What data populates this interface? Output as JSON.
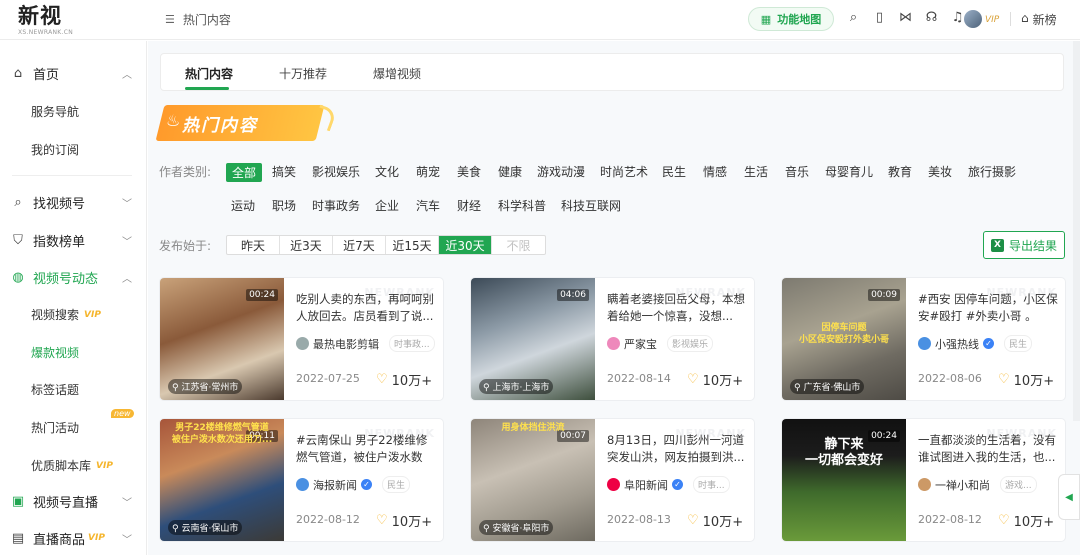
{
  "brand": {
    "title": "新视",
    "subtitle": "XS.NEWRANK.CN"
  },
  "header": {
    "breadcrumb": "热门内容",
    "function_map": "功能地图",
    "new_rank": "新榜",
    "icons": [
      "search-icon",
      "phone-icon",
      "brand-icon",
      "headset-icon",
      "bell-icon"
    ],
    "accent": "#21a651"
  },
  "sidebar": {
    "home": "首页",
    "service_nav": "服务导航",
    "subscriptions": "我的订阅",
    "find_channel": "找视频号",
    "index_rank": "指数榜单",
    "channel_dynamics": "视频号动态",
    "video_search": "视频搜索",
    "viral_videos": "爆款视频",
    "tag_topics": "标签话题",
    "hot_events": "热门活动",
    "quality_scripts": "优质脚本库",
    "live": "视频号直播",
    "live_goods": "直播商品",
    "vip": "VIP",
    "new": "new"
  },
  "tabs": [
    "热门内容",
    "十万推荐",
    "爆增视频"
  ],
  "banner": "热门内容",
  "filters": {
    "author_label": "作者类别:",
    "categories_row1": [
      "全部",
      "搞笑",
      "影视娱乐",
      "文化",
      "萌宠",
      "美食",
      "健康",
      "游戏动漫",
      "时尚艺术",
      "民生",
      "情感",
      "生活",
      "音乐",
      "母婴育儿",
      "教育",
      "美妆",
      "旅行摄影"
    ],
    "categories_row2": [
      "运动",
      "职场",
      "时事政务",
      "企业",
      "汽车",
      "财经",
      "科学科普",
      "科技互联网"
    ],
    "publish_label": "发布始于:",
    "dates": [
      "昨天",
      "近3天",
      "近7天",
      "近15天",
      "近30天",
      "不限"
    ],
    "active_date_index": 4,
    "export": "导出结果"
  },
  "cards": [
    {
      "duration": "00:24",
      "location": "江苏省·常州市",
      "title": "吃别人卖的东西，再呵呵别人放回去。店员看到了说...",
      "author": "最热电影剪辑",
      "category": "时事政...",
      "date": "2022-07-25",
      "likes": "10万+",
      "overlay": "",
      "verified": false
    },
    {
      "duration": "04:06",
      "location": "上海市·上海市",
      "title": "瞒着老婆接回岳父母，本想着给她一个惊喜，没想...",
      "author": "严家宝",
      "category": "影视娱乐",
      "date": "2022-08-14",
      "likes": "10万+",
      "overlay": "",
      "verified": false
    },
    {
      "duration": "00:09",
      "location": "广东省·佛山市",
      "title": "#西安 因停车问题，小区保安#殴打 #外卖小哥 。",
      "author": "小强热线",
      "category": "民生",
      "date": "2022-08-06",
      "likes": "10万+",
      "overlay": "因停车问题\n小区保安殴打外卖小哥",
      "verified": true
    },
    {
      "duration": "00:11",
      "location": "云南省·保山市",
      "title": "#云南保山 男子22楼维修燃气管道，被住户泼水数次...",
      "author": "海报新闻",
      "category": "民生",
      "date": "2022-08-12",
      "likes": "10万+",
      "overlay": "男子22楼维修燃气管道\n被住户泼水数次还用刀...",
      "verified": true
    },
    {
      "duration": "00:07",
      "location": "安徽省·阜阳市",
      "title": "8月13日，四川彭州一河道突发山洪，网友拍摄到洪...",
      "author": "阜阳新闻",
      "category": "时事...",
      "date": "2022-08-13",
      "likes": "10万+",
      "overlay": "用身体挡住洪流",
      "verified": true
    },
    {
      "duration": "00:24",
      "location": "",
      "title": "一直都淡淡的生活着，没有谁试图进入我的生活，也...",
      "author": "一禅小和尚",
      "category": "游戏...",
      "date": "2022-08-12",
      "likes": "10万+",
      "overlay": "静下来\n一切都会变好",
      "verified": false
    }
  ]
}
